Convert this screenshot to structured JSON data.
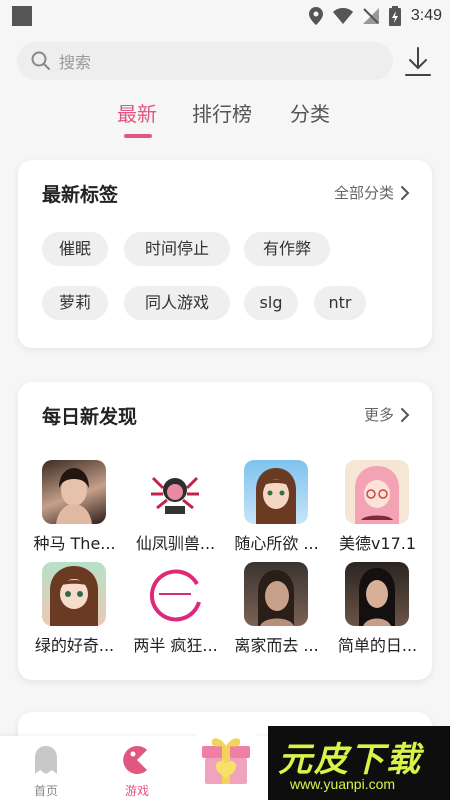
{
  "status_bar": {
    "time": "3:49"
  },
  "search": {
    "placeholder": "搜索"
  },
  "tabs": [
    {
      "label": "最新",
      "active": true
    },
    {
      "label": "排行榜",
      "active": false
    },
    {
      "label": "分类",
      "active": false
    }
  ],
  "latest_tags": {
    "title": "最新标签",
    "more_label": "全部分类",
    "tags": [
      "催眠",
      "时间停止",
      "有作弊",
      "萝莉",
      "同人游戏",
      "slg",
      "ntr"
    ]
  },
  "daily": {
    "title": "每日新发现",
    "more_label": "更多",
    "apps": [
      {
        "name": "种马 The..."
      },
      {
        "name": "仙凤驯兽..."
      },
      {
        "name": "随心所欲 ..."
      },
      {
        "name": "美德v17.1"
      },
      {
        "name": "绿的好奇..."
      },
      {
        "name": "两半 疯狂..."
      },
      {
        "name": "离家而去 ..."
      },
      {
        "name": "简单的日..."
      }
    ]
  },
  "bottom_nav": [
    {
      "label": "首页",
      "active": false,
      "icon": "ghost-icon"
    },
    {
      "label": "游戏",
      "active": true,
      "icon": "game-icon"
    }
  ],
  "watermark": {
    "title": "元皮下载",
    "url": "www.yuanpi.com"
  },
  "colors": {
    "accent": "#e0577f",
    "watermark": "#d8f34a"
  }
}
